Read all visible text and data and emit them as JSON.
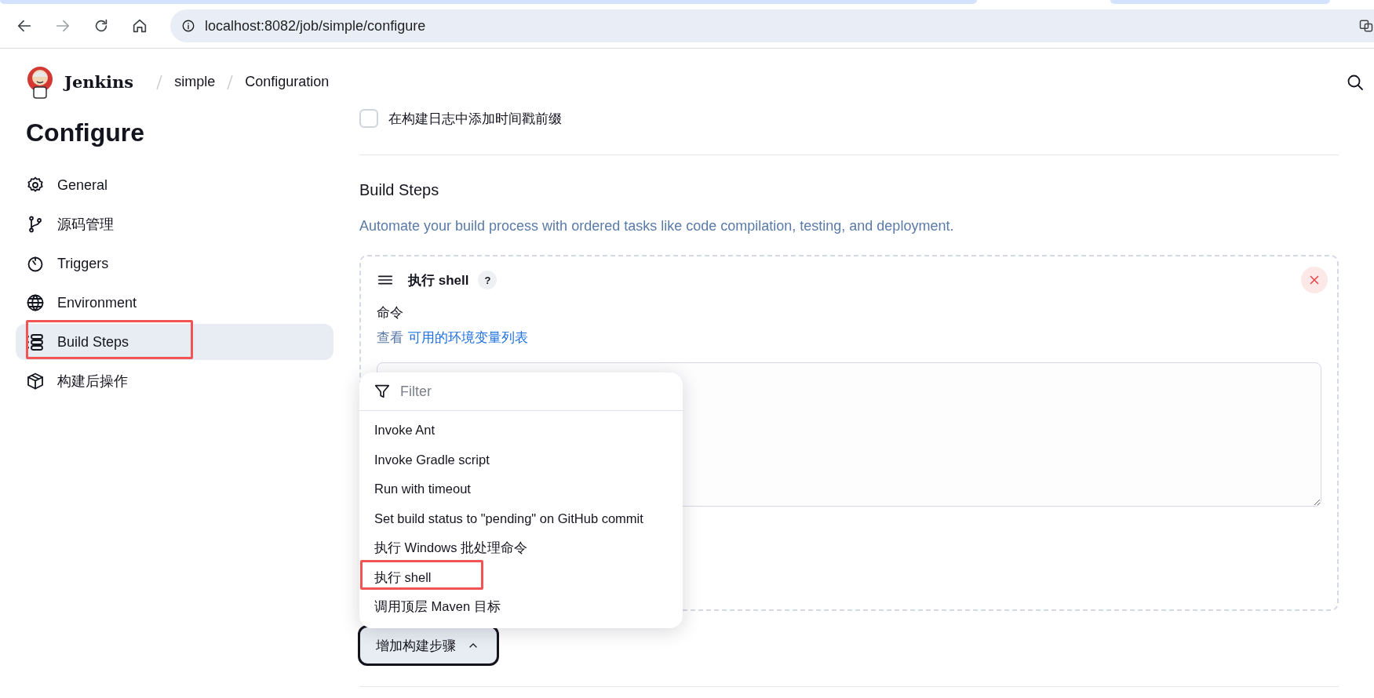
{
  "browser": {
    "nav": [
      {
        "kind": "back",
        "disabled": false
      },
      {
        "kind": "forward",
        "disabled": true
      },
      {
        "kind": "reload",
        "disabled": false
      },
      {
        "kind": "home",
        "disabled": false
      }
    ],
    "url": "localhost:8082/job/simple/configure"
  },
  "header": {
    "brand": "Jenkins",
    "breadcrumbs": [
      "simple",
      "Configuration"
    ]
  },
  "sidebar": {
    "title": "Configure",
    "items": [
      {
        "label": "General",
        "kind": "gear",
        "selected": false,
        "highlighted": false
      },
      {
        "label": "源码管理",
        "kind": "branch",
        "selected": false,
        "highlighted": false
      },
      {
        "label": "Triggers",
        "kind": "timer",
        "selected": false,
        "highlighted": false
      },
      {
        "label": "Environment",
        "kind": "globe",
        "selected": false,
        "highlighted": false
      },
      {
        "label": "Build Steps",
        "kind": "list",
        "selected": true,
        "highlighted": true
      },
      {
        "label": "构建后操作",
        "kind": "package",
        "selected": false,
        "highlighted": false
      }
    ]
  },
  "main": {
    "timestamp_option": {
      "label": "在构建日志中添加时间戳前缀",
      "checked": false
    },
    "section": {
      "title": "Build Steps",
      "description": "Automate your build process with ordered tasks like code compilation, testing, and deployment."
    },
    "step": {
      "title": "执行 shell",
      "help": "?",
      "field_label": "命令",
      "hint_prefix": "查看",
      "hint_link": "可用的环境变量列表"
    },
    "menu": {
      "placeholder": "Filter",
      "items": [
        {
          "label": "Invoke Ant",
          "highlighted": false
        },
        {
          "label": "Invoke Gradle script",
          "highlighted": false
        },
        {
          "label": "Run with timeout",
          "highlighted": false
        },
        {
          "label": "Set build status to \"pending\" on GitHub commit",
          "highlighted": false
        },
        {
          "label": "执行 Windows 批处理命令",
          "highlighted": false
        },
        {
          "label": "执行 shell",
          "highlighted": true
        },
        {
          "label": "调用顶层 Maven 目标",
          "highlighted": false
        }
      ]
    },
    "add_button": {
      "label": "增加构建步骤",
      "expanded": true
    }
  }
}
